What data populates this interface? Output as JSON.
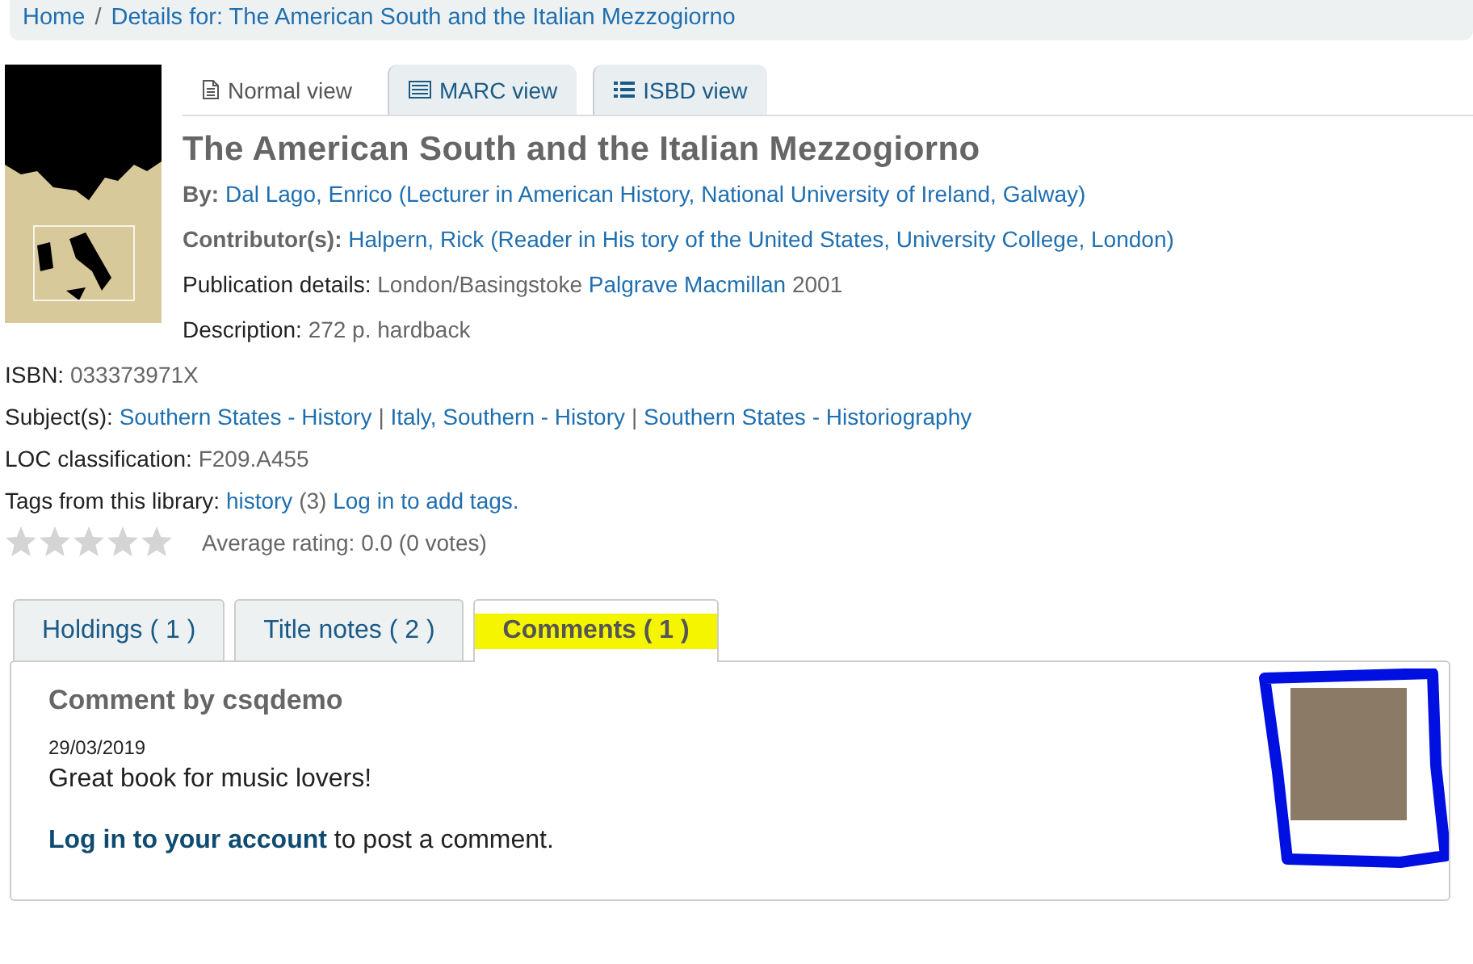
{
  "breadcrumb": [
    "Home",
    "Details for: The American South and the Italian Mezzogiorno"
  ],
  "breadcrumb_separator": "/",
  "views": [
    {
      "label": "Normal view",
      "kind": "normal",
      "selected": true
    },
    {
      "label": "MARC view",
      "kind": "marc",
      "selected": false
    },
    {
      "label": "ISBD view",
      "kind": "isbd",
      "selected": false
    }
  ],
  "title": "The American South and the Italian Mezzogiorno",
  "by": {
    "label": "By:",
    "value": "Dal Lago, Enrico (Lecturer in American History, National University of Ireland, Galway)"
  },
  "contributors": {
    "label": "Contributor(s):",
    "value": "Halpern, Rick (Reader in His tory of the United States, University College, London)"
  },
  "publication": {
    "label": "Publication details:",
    "place": "London/Basingstoke",
    "publisher": "Palgrave Macmillan",
    "year": "2001"
  },
  "description": {
    "label": "Description:",
    "value": "272 p. hardback"
  },
  "isbn": {
    "label": "ISBN:",
    "value": "033373971X"
  },
  "subjects": {
    "label": "Subject(s):",
    "separator": "|",
    "items": [
      "Southern States - History",
      "Italy, Southern - History",
      "Southern States - Historiography"
    ]
  },
  "loc": {
    "label": "LOC classification:",
    "value": "F209.A455"
  },
  "tags": {
    "label": "Tags from this library:",
    "tag": "history",
    "count": "(3)",
    "login": "Log in to add tags."
  },
  "rating": {
    "stars": 0,
    "text": "Average rating: 0.0 (0 votes)"
  },
  "tabs": [
    {
      "label": "Holdings ( 1 )",
      "selected": false
    },
    {
      "label": "Title notes ( 2 )",
      "selected": false
    },
    {
      "label": "Comments ( 1 )",
      "selected": true
    }
  ],
  "comment": {
    "heading": "Comment by csqdemo",
    "date": "29/03/2019",
    "text": "Great book for music lovers!",
    "login_link": "Log in to your account",
    "login_rest": " to post a comment."
  }
}
